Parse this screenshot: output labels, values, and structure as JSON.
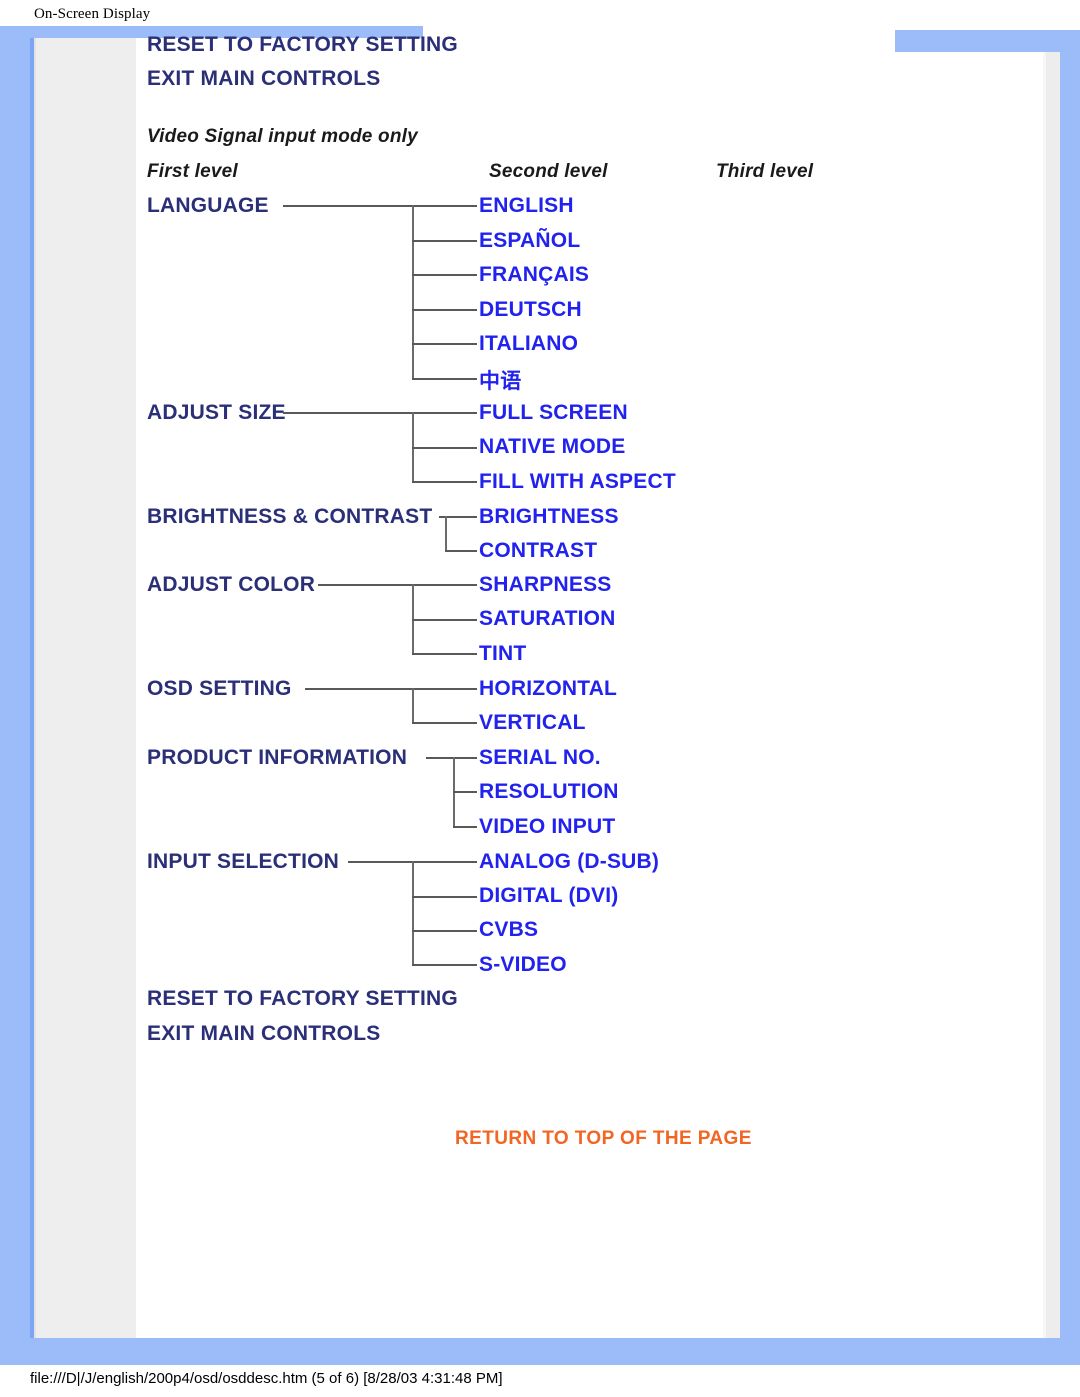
{
  "document": {
    "title": "On-Screen Display",
    "footer_path": "file:///D|/J/english/200p4/osd/osddesc.htm (5 of 6) [8/28/03 4:31:48 PM]"
  },
  "colors": {
    "frame_blue": "#9cbcf9",
    "sidebar_gray": "#eeeeee",
    "level1_text": "#2b2f77",
    "level2_text": "#2222ee",
    "link_orange": "#f26522",
    "connector": "#595959"
  },
  "top_items": [
    {
      "label": "RESET TO FACTORY SETTING"
    },
    {
      "label": "EXIT MAIN CONTROLS"
    }
  ],
  "section_note": "Video Signal input mode only",
  "column_headers": {
    "first": "First level",
    "second": "Second level",
    "third": "Third level"
  },
  "tree": [
    {
      "first": "LANGUAGE",
      "second": [
        "ENGLISH",
        "ESPAÑOL",
        "FRANÇAIS",
        "DEUTSCH",
        "ITALIANO",
        "中语"
      ]
    },
    {
      "first": "ADJUST SIZE",
      "second": [
        "FULL SCREEN",
        "NATIVE MODE",
        "FILL WITH ASPECT"
      ]
    },
    {
      "first": "BRIGHTNESS & CONTRAST",
      "second": [
        "BRIGHTNESS",
        "CONTRAST"
      ]
    },
    {
      "first": "ADJUST COLOR",
      "second": [
        "SHARPNESS",
        "SATURATION",
        "TINT"
      ]
    },
    {
      "first": "OSD SETTING",
      "second": [
        "HORIZONTAL",
        "VERTICAL"
      ]
    },
    {
      "first": "PRODUCT INFORMATION",
      "second": [
        "SERIAL NO.",
        "RESOLUTION",
        "VIDEO INPUT"
      ]
    },
    {
      "first": "INPUT SELECTION",
      "second": [
        "ANALOG (D-SUB)",
        "DIGITAL (DVI)",
        "CVBS",
        "S-VIDEO"
      ]
    }
  ],
  "bottom_items": [
    {
      "label": "RESET TO FACTORY SETTING"
    },
    {
      "label": "EXIT MAIN CONTROLS"
    }
  ],
  "return_link": "RETURN TO TOP OF THE PAGE"
}
